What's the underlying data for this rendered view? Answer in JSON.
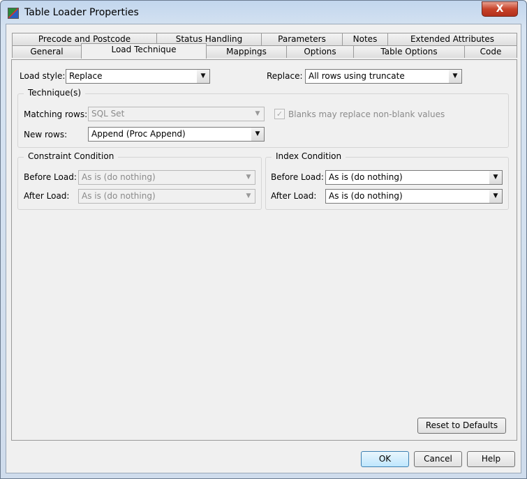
{
  "window": {
    "title": "Table Loader Properties",
    "close": "X"
  },
  "tabs_row1": [
    "Precode and Postcode",
    "Status Handling",
    "Parameters",
    "Notes",
    "Extended Attributes"
  ],
  "tabs_row2": [
    "General",
    "Load Technique",
    "Mappings",
    "Options",
    "Table Options",
    "Code"
  ],
  "active_tab": "Load Technique",
  "load_style": {
    "label": "Load style:",
    "value": "Replace"
  },
  "replace": {
    "label": "Replace:",
    "value": "All rows using truncate"
  },
  "techniques": {
    "title": "Technique(s)",
    "matching_label": "Matching rows:",
    "matching_value": "SQL Set",
    "new_label": "New rows:",
    "new_value": "Append (Proc Append)",
    "blanks_label": "Blanks may replace non-blank values",
    "blanks_checked": true
  },
  "constraint": {
    "title": "Constraint Condition",
    "before_label": "Before Load:",
    "before_value": "As is (do nothing)",
    "after_label": "After Load:",
    "after_value": "As is (do nothing)"
  },
  "index": {
    "title": "Index Condition",
    "before_label": "Before Load:",
    "before_value": "As is (do nothing)",
    "after_label": "After Load:",
    "after_value": "As is (do nothing)"
  },
  "buttons": {
    "reset": "Reset to Defaults",
    "ok": "OK",
    "cancel": "Cancel",
    "help": "Help"
  },
  "arrow": "▼",
  "check": "✓"
}
